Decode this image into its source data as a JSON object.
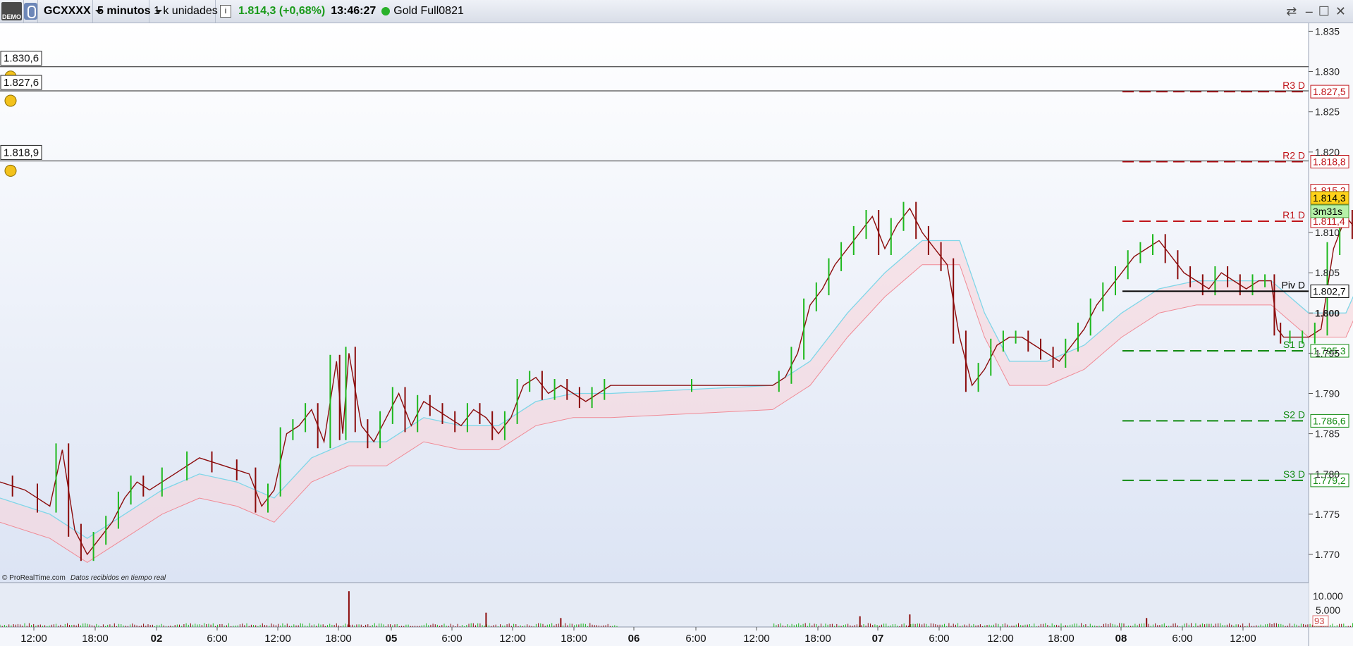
{
  "toolbar": {
    "demo_badge": "DEMO",
    "symbol": "GCXXXX",
    "timeframe": "5 minutos",
    "units": "1 k unidades",
    "info": "i",
    "last_change": "1.814,3 (+0,68%)",
    "time": "13:46:27",
    "instrument": "Gold Full0821",
    "icons": [
      "demo-icon",
      "link-icon",
      "info-icon",
      "status-dot-icon",
      "sync-icon",
      "minimize-icon",
      "maximize-icon",
      "close-icon"
    ],
    "minimize": "–",
    "maximize": "☐",
    "close": "✕"
  },
  "colors": {
    "background_top": "#ffffff",
    "background_bottom": "#dce4f4",
    "resistance": "#c0141a",
    "support": "#118a11",
    "pivot": "#000000",
    "candle_up": "#1db81d",
    "candle_down": "#8b0b0b",
    "cloud_line": "#7fd6e8",
    "cloud_fill": "#f9d4d8",
    "last_price_bg": "#ffd21a",
    "countdown_bg": "#b6f0a8"
  },
  "alerts": [
    {
      "label": "1.830,6",
      "value": 1830.6
    },
    {
      "label": "1.827,6",
      "value": 1827.6
    },
    {
      "label": "1.818,9",
      "value": 1818.9
    }
  ],
  "levels": [
    {
      "name": "R3 D",
      "value": 1827.5,
      "label": "1.827,5",
      "style": "dashed",
      "color": "#c0141a"
    },
    {
      "name": "R2 D",
      "value": 1818.8,
      "label": "1.818,8",
      "style": "dashed",
      "color": "#c0141a"
    },
    {
      "name": "R1 D",
      "value": 1811.4,
      "label": "1.811,4",
      "style": "dashed",
      "color": "#c0141a"
    },
    {
      "name": "Piv D",
      "value": 1802.7,
      "label": "1.802,7",
      "style": "solid",
      "color": "#000000"
    },
    {
      "name": "S1 D",
      "value": 1795.3,
      "label": "1.795,3",
      "style": "dashed",
      "color": "#118a11"
    },
    {
      "name": "S2 D",
      "value": 1786.6,
      "label": "1.786,6",
      "style": "dashed",
      "color": "#118a11"
    },
    {
      "name": "S3 D",
      "value": 1779.2,
      "label": "1.779,2",
      "style": "dashed",
      "color": "#118a11"
    }
  ],
  "price_tags": {
    "extra": {
      "value": 1815.2,
      "label": "1.815,2"
    },
    "last": {
      "value": 1814.3,
      "label": "1.814,3"
    },
    "countdown": "3m31s"
  },
  "volume_axis": {
    "ticks": [
      "10.000",
      "5.000"
    ],
    "current": "93"
  },
  "footer": {
    "copyright": "© ProRealTime.com",
    "note": "Datos recibidos en tiempo real"
  },
  "chart_data": {
    "type": "line",
    "title": "",
    "ylim": [
      1766.5,
      1836
    ],
    "y_ticks": [
      {
        "label": "1.835",
        "value": 1835
      },
      {
        "label": "1.830",
        "value": 1830
      },
      {
        "label": "1.825",
        "value": 1825
      },
      {
        "label": "1.820",
        "value": 1820
      },
      {
        "label": "1.810",
        "value": 1810
      },
      {
        "label": "1.805",
        "value": 1805
      },
      {
        "label": "1.800",
        "value": 1800,
        "bold": true
      },
      {
        "label": "1.795",
        "value": 1795
      },
      {
        "label": "1.790",
        "value": 1790
      },
      {
        "label": "1.785",
        "value": 1785
      },
      {
        "label": "1.780",
        "value": 1780
      },
      {
        "label": "1.775",
        "value": 1775
      },
      {
        "label": "1.770",
        "value": 1770
      }
    ],
    "x_ticks": [
      "12:00",
      "18:00",
      "02",
      "6:00",
      "12:00",
      "18:00",
      "05",
      "6:00",
      "12:00",
      "18:00",
      "06",
      "6:00",
      "12:00",
      "18:00",
      "07",
      "6:00",
      "12:00",
      "18:00",
      "08",
      "6:00",
      "12:00"
    ],
    "x_tick_bold": [
      false,
      false,
      true,
      false,
      false,
      false,
      true,
      false,
      false,
      false,
      true,
      false,
      false,
      false,
      true,
      false,
      false,
      false,
      true,
      false,
      false
    ],
    "x_range": [
      -2,
      103
    ],
    "x_ticks_hours": [
      0,
      6,
      12,
      18,
      24,
      30,
      36,
      42,
      48,
      54,
      60,
      66,
      72,
      78,
      84,
      90,
      96,
      102
    ],
    "x_tick_index": [
      0,
      1,
      2,
      3,
      4,
      5,
      6,
      7,
      8,
      9,
      10,
      11,
      12,
      13,
      14,
      15,
      16,
      17,
      18,
      19,
      20
    ],
    "price_series": {
      "name": "",
      "points": [
        [
          -2,
          1779
        ],
        [
          0,
          1778
        ],
        [
          2,
          1776
        ],
        [
          3,
          1783
        ],
        [
          4,
          1773
        ],
        [
          5,
          1770
        ],
        [
          6,
          1772
        ],
        [
          7,
          1774
        ],
        [
          8,
          1777
        ],
        [
          9,
          1779
        ],
        [
          10,
          1778
        ],
        [
          12,
          1780
        ],
        [
          14,
          1782
        ],
        [
          16,
          1781
        ],
        [
          18,
          1780
        ],
        [
          19,
          1776
        ],
        [
          20,
          1778
        ],
        [
          21,
          1785
        ],
        [
          22,
          1786
        ],
        [
          23,
          1788
        ],
        [
          24,
          1784
        ],
        [
          25,
          1794
        ],
        [
          25.5,
          1785
        ],
        [
          26,
          1795
        ],
        [
          27,
          1786
        ],
        [
          28,
          1784
        ],
        [
          29,
          1787
        ],
        [
          30,
          1790
        ],
        [
          31,
          1786
        ],
        [
          32,
          1789
        ],
        [
          33,
          1788
        ],
        [
          34,
          1787
        ],
        [
          35,
          1786
        ],
        [
          36,
          1788
        ],
        [
          37,
          1787
        ],
        [
          38,
          1785
        ],
        [
          39,
          1787
        ],
        [
          40,
          1791
        ],
        [
          41,
          1792
        ],
        [
          42,
          1790
        ],
        [
          43,
          1791
        ],
        [
          44,
          1790
        ],
        [
          45,
          1789
        ],
        [
          46,
          1790
        ],
        [
          47,
          1791
        ],
        [
          60,
          1791
        ],
        [
          61,
          1792
        ],
        [
          62,
          1795
        ],
        [
          63,
          1801
        ],
        [
          64,
          1803
        ],
        [
          65,
          1806
        ],
        [
          66,
          1808
        ],
        [
          67,
          1810
        ],
        [
          68,
          1812
        ],
        [
          69,
          1808
        ],
        [
          70,
          1811
        ],
        [
          71,
          1813
        ],
        [
          72,
          1810
        ],
        [
          73,
          1808
        ],
        [
          74,
          1806
        ],
        [
          75,
          1797
        ],
        [
          76,
          1791
        ],
        [
          77,
          1793
        ],
        [
          78,
          1796
        ],
        [
          79,
          1797
        ],
        [
          80,
          1797
        ],
        [
          81,
          1796
        ],
        [
          82,
          1795
        ],
        [
          83,
          1794
        ],
        [
          84,
          1796
        ],
        [
          85,
          1798
        ],
        [
          86,
          1801
        ],
        [
          87,
          1803
        ],
        [
          88,
          1805
        ],
        [
          89,
          1807
        ],
        [
          90,
          1808
        ],
        [
          91,
          1809
        ],
        [
          92,
          1807
        ],
        [
          93,
          1805
        ],
        [
          94,
          1804
        ],
        [
          95,
          1803
        ],
        [
          96,
          1805
        ],
        [
          97,
          1804
        ],
        [
          98,
          1803
        ],
        [
          99,
          1804
        ],
        [
          100,
          1804
        ],
        [
          100.5,
          1798
        ],
        [
          101,
          1797
        ],
        [
          102,
          1797
        ],
        [
          103,
          1797
        ],
        [
          104,
          1798
        ],
        [
          105,
          1808
        ],
        [
          106,
          1812
        ],
        [
          107,
          1810
        ],
        [
          108,
          1816
        ],
        [
          108.7,
          1812
        ],
        [
          109.3,
          1814.3
        ]
      ]
    },
    "cloud_series": {
      "name": "",
      "points": [
        [
          -2,
          1777
        ],
        [
          2,
          1775
        ],
        [
          5,
          1772
        ],
        [
          8,
          1775
        ],
        [
          11,
          1778
        ],
        [
          14,
          1780
        ],
        [
          17,
          1779
        ],
        [
          20,
          1777
        ],
        [
          23,
          1782
        ],
        [
          26,
          1784
        ],
        [
          29,
          1784
        ],
        [
          32,
          1787
        ],
        [
          35,
          1786
        ],
        [
          38,
          1786
        ],
        [
          41,
          1789
        ],
        [
          44,
          1790
        ],
        [
          47,
          1790
        ],
        [
          60,
          1791
        ],
        [
          63,
          1794
        ],
        [
          66,
          1800
        ],
        [
          69,
          1805
        ],
        [
          72,
          1809
        ],
        [
          75,
          1809
        ],
        [
          77,
          1800
        ],
        [
          79,
          1794
        ],
        [
          82,
          1794
        ],
        [
          85,
          1796
        ],
        [
          88,
          1800
        ],
        [
          91,
          1803
        ],
        [
          94,
          1804
        ],
        [
          97,
          1804
        ],
        [
          100,
          1804
        ],
        [
          103,
          1800
        ],
        [
          106,
          1800
        ],
        [
          108,
          1807
        ],
        [
          110,
          1811
        ]
      ]
    },
    "volume_series": {
      "name": "",
      "values_note_units": "contracts",
      "spikes": [
        [
          26,
          10000
        ],
        [
          37,
          4000
        ],
        [
          43,
          2500
        ],
        [
          67,
          3000
        ],
        [
          71,
          3500
        ],
        [
          90,
          2500
        ],
        [
          104,
          3000
        ],
        [
          107,
          2500
        ]
      ],
      "ylim": [
        0,
        12000
      ]
    }
  }
}
